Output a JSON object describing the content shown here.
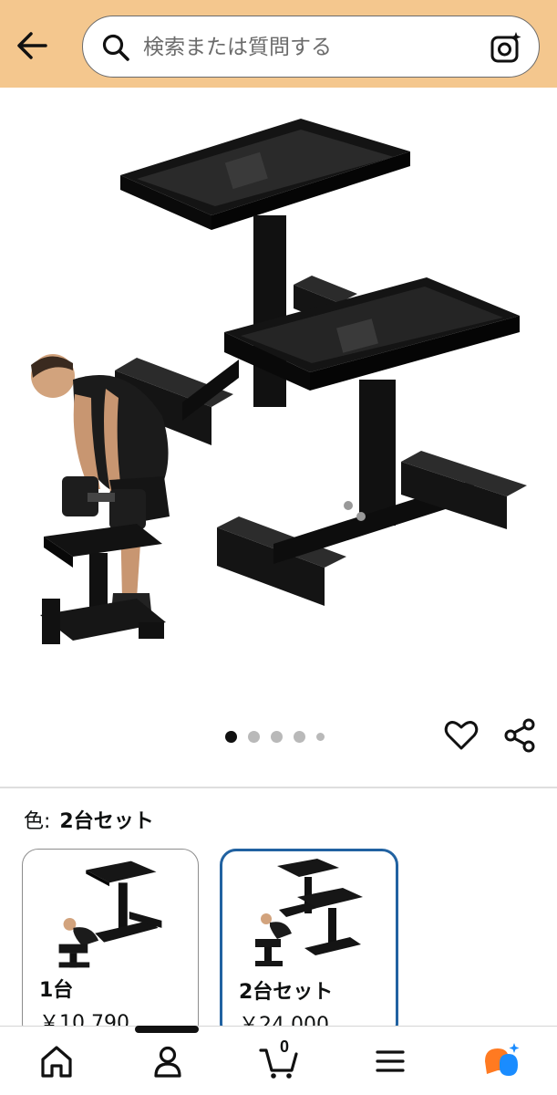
{
  "header": {
    "search_placeholder": "検索または質問する",
    "background_color": "#f4c78e",
    "icons": {
      "back": "back-arrow-icon",
      "search": "search-icon",
      "camera": "camera-lens-icon"
    }
  },
  "carousel": {
    "image_count": 5,
    "active_index": 0,
    "icons": {
      "favorite": "heart-icon",
      "share": "share-icon"
    }
  },
  "variants": {
    "label": "色:",
    "selected_value": "2台セット",
    "options": [
      {
        "name": "1台",
        "price": "￥10,790",
        "selected": false
      },
      {
        "name": "2台セット",
        "price": "￥24,000",
        "selected": true
      }
    ],
    "selected_border_color": "#2162a1"
  },
  "bottom_nav": {
    "cart_count": "0",
    "items": [
      "home-icon",
      "account-icon",
      "cart-icon",
      "menu-icon",
      "rufus-ai-icon"
    ]
  }
}
